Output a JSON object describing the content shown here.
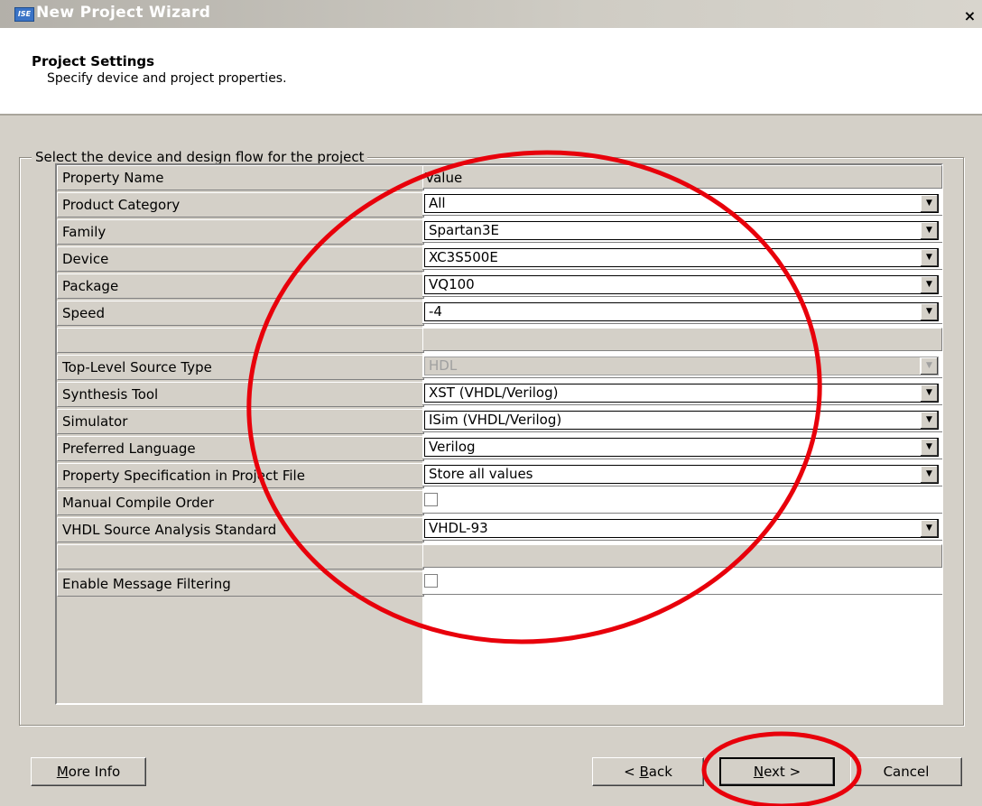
{
  "window": {
    "title": "New Project Wizard",
    "icon_text": "ISE",
    "close_label": "×"
  },
  "header": {
    "title": "Project Settings",
    "subtitle": "Specify device and project properties."
  },
  "group": {
    "legend": "Select the device and design flow for the project"
  },
  "grid": {
    "col_name": "Property Name",
    "col_value": "Value",
    "rows": [
      {
        "name": "Product Category",
        "type": "combo",
        "value": "All"
      },
      {
        "name": "Family",
        "type": "combo",
        "value": "Spartan3E"
      },
      {
        "name": "Device",
        "type": "combo",
        "value": "XC3S500E"
      },
      {
        "name": "Package",
        "type": "combo",
        "value": "VQ100"
      },
      {
        "name": "Speed",
        "type": "combo",
        "value": "-4"
      },
      {
        "name": "",
        "type": "blank",
        "value": ""
      },
      {
        "name": "Top-Level Source Type",
        "type": "combo-disabled",
        "value": "HDL"
      },
      {
        "name": "Synthesis Tool",
        "type": "combo",
        "value": "XST (VHDL/Verilog)"
      },
      {
        "name": "Simulator",
        "type": "combo",
        "value": "ISim (VHDL/Verilog)"
      },
      {
        "name": "Preferred Language",
        "type": "combo",
        "value": "Verilog"
      },
      {
        "name": "Property Specification in Project File",
        "type": "combo",
        "value": "Store all values"
      },
      {
        "name": "Manual Compile Order",
        "type": "checkbox",
        "checked": false
      },
      {
        "name": "VHDL Source Analysis Standard",
        "type": "combo",
        "value": "VHDL-93"
      },
      {
        "name": "",
        "type": "blank",
        "value": ""
      },
      {
        "name": "Enable Message Filtering",
        "type": "checkbox",
        "checked": false
      }
    ]
  },
  "buttons": {
    "more_info": {
      "label": "More Info",
      "mnemonic": "M"
    },
    "back": {
      "label": "< Back",
      "mnemonic": "B"
    },
    "next": {
      "label": "Next >",
      "mnemonic": "N"
    },
    "cancel": {
      "label": "Cancel"
    }
  },
  "annotations": {
    "color": "#e8000b"
  }
}
